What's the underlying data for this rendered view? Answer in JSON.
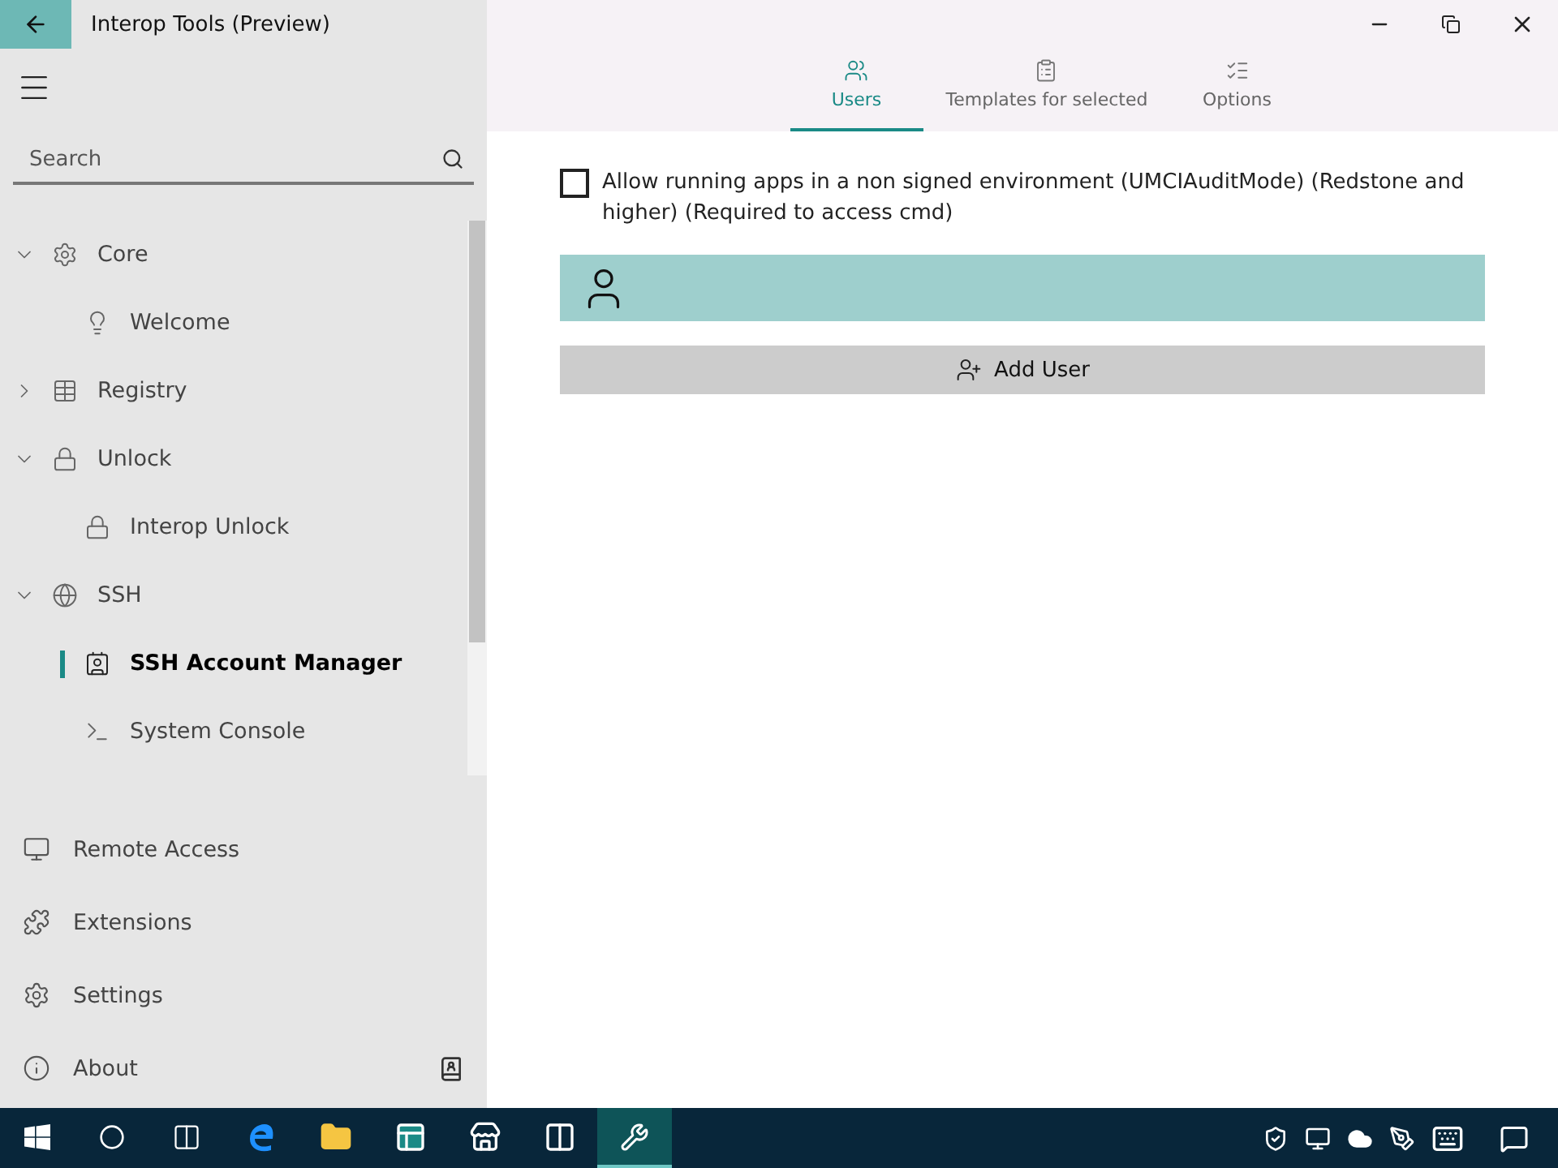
{
  "window": {
    "title": "Interop Tools (Preview)"
  },
  "sidebar": {
    "search": {
      "placeholder": "Search"
    },
    "tree": [
      {
        "label": "Core",
        "expanded": true,
        "selected": false,
        "children": [
          {
            "label": "Welcome",
            "selected": false
          }
        ]
      },
      {
        "label": "Registry",
        "expanded": false,
        "selected": false
      },
      {
        "label": "Unlock",
        "expanded": true,
        "selected": false,
        "children": [
          {
            "label": "Interop Unlock",
            "selected": false
          }
        ]
      },
      {
        "label": "SSH",
        "expanded": true,
        "selected": false,
        "children": [
          {
            "label": "SSH Account Manager",
            "selected": true
          },
          {
            "label": "System Console",
            "selected": false
          }
        ]
      }
    ],
    "footer_items": [
      {
        "label": "Remote Access"
      },
      {
        "label": "Extensions"
      },
      {
        "label": "Settings"
      },
      {
        "label": "About"
      }
    ]
  },
  "tabs": [
    {
      "label": "Users",
      "selected": true
    },
    {
      "label": "Templates for selected",
      "selected": false
    },
    {
      "label": "Options",
      "selected": false
    }
  ],
  "audit_mode": {
    "label": "Allow running apps in a non signed environment (UMCIAuditMode) (Redstone and higher) (Required to access cmd)",
    "checked": false
  },
  "add_user_button": "Add User",
  "taskbar": {
    "apps": [
      {
        "selected": false
      },
      {
        "selected": false
      },
      {
        "selected": false
      },
      {
        "selected": false
      },
      {
        "selected": false
      },
      {
        "selected": true
      }
    ]
  }
}
